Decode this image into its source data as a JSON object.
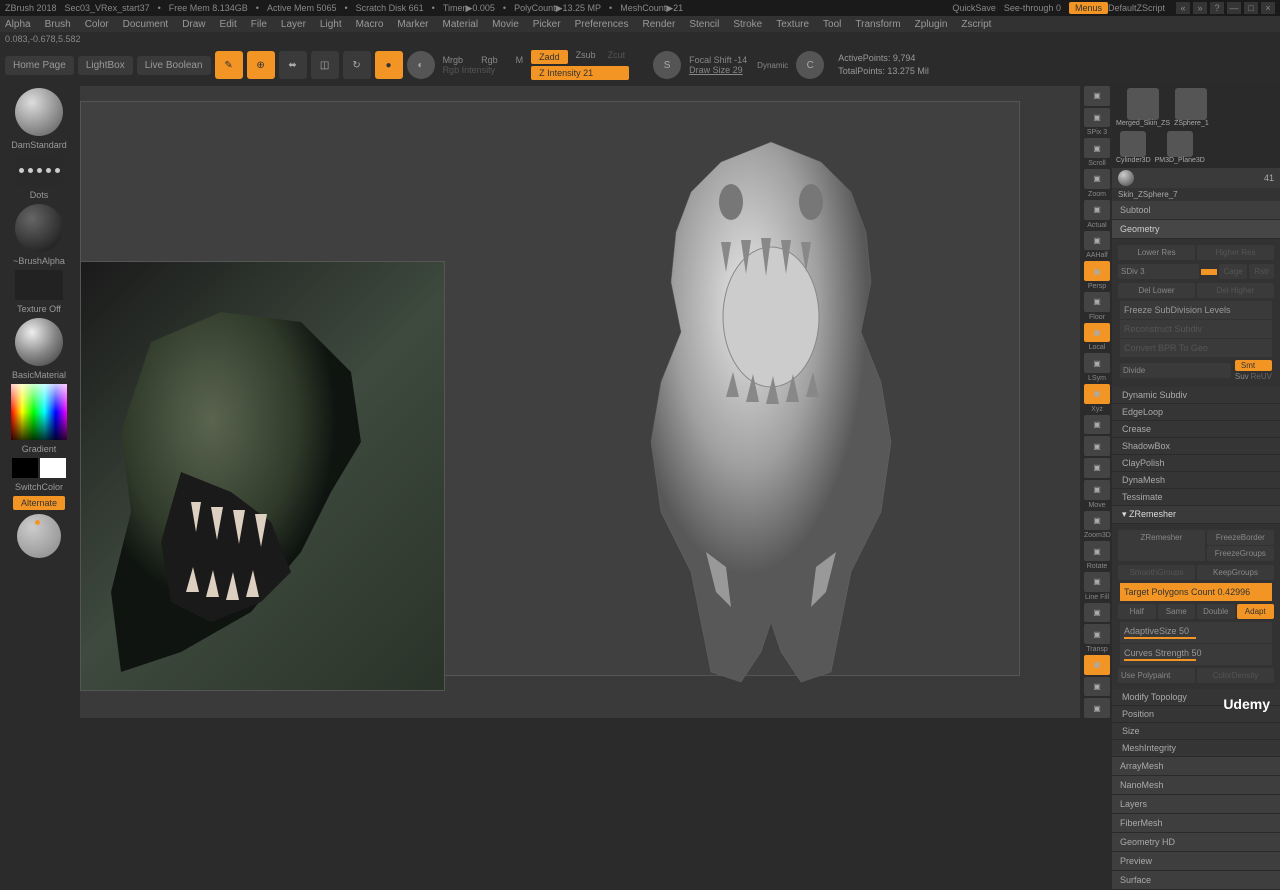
{
  "titlebar": {
    "app": "ZBrush 2018",
    "file": "Sec03_VRex_start37",
    "mem": "Free Mem 8.134GB",
    "activemem": "Active Mem 5065",
    "scratch": "Scratch Disk 661",
    "timer": "Timer▶0.005",
    "poly": "PolyCount▶13.25 MP",
    "mesh": "MeshCount▶21",
    "quicksave": "QuickSave",
    "seethrough": "See-through  0",
    "menus": "Menus",
    "script": "DefaultZScript"
  },
  "menubar": [
    "Alpha",
    "Brush",
    "Color",
    "Document",
    "Draw",
    "Edit",
    "File",
    "Layer",
    "Light",
    "Macro",
    "Marker",
    "Material",
    "Movie",
    "Picker",
    "Preferences",
    "Render",
    "Stencil",
    "Stroke",
    "Texture",
    "Tool",
    "Transform",
    "Zplugin",
    "Zscript"
  ],
  "coords": "0.083,-0.678,5.582",
  "toolbar": {
    "home": "Home Page",
    "lightbox": "LightBox",
    "liveboolean": "Live Boolean",
    "mrgb": "Mrgb",
    "rgb": "Rgb",
    "m": "M",
    "rgbint": "Rgb Intensity",
    "zadd": "Zadd",
    "zsub": "Zsub",
    "zcut": "Zcut",
    "zint": "Z Intensity 21",
    "focal": "Focal Shift -14",
    "drawsize": "Draw Size 29",
    "dynamic": "Dynamic",
    "activepoints": "ActivePoints: 9,794",
    "totalpoints": "TotalPoints: 13.275 Mil"
  },
  "left": {
    "brush": "DamStandard",
    "stroke": "Dots",
    "alpha": "~BrushAlpha",
    "texture": "Texture Off",
    "material": "BasicMaterial",
    "gradient": "Gradient",
    "switchcolor": "SwitchColor",
    "alternate": "Alternate"
  },
  "sideIcons": [
    {
      "label": "",
      "name": "bpr-icon"
    },
    {
      "label": "SPix 3",
      "name": "spix-icon"
    },
    {
      "label": "Scroll",
      "name": "scroll-icon"
    },
    {
      "label": "Zoom",
      "name": "zoom-icon"
    },
    {
      "label": "Actual",
      "name": "actual-icon"
    },
    {
      "label": "AAHalf",
      "name": "aahalf-icon"
    },
    {
      "label": "Persp",
      "name": "persp-icon",
      "active": true
    },
    {
      "label": "Floor",
      "name": "floor-icon"
    },
    {
      "label": "Local",
      "name": "local-icon",
      "active": true
    },
    {
      "label": "LSym",
      "name": "lsym-icon"
    },
    {
      "label": "Xyz",
      "name": "xpose-icon",
      "active": true
    },
    {
      "label": "",
      "name": "fit-icon"
    },
    {
      "label": "",
      "name": "frame-icon"
    },
    {
      "label": "",
      "name": "xyz2-icon"
    },
    {
      "label": "Move",
      "name": "move-icon"
    },
    {
      "label": "Zoom3D",
      "name": "zoom3d-icon"
    },
    {
      "label": "Rotate",
      "name": "rotate-icon"
    },
    {
      "label": "Line Fill",
      "name": "linefill-icon"
    },
    {
      "label": "",
      "name": "polyf-icon"
    },
    {
      "label": "Transp",
      "name": "transp-icon"
    },
    {
      "label": "",
      "name": "ghost-icon",
      "active": true
    },
    {
      "label": "",
      "name": "solo-icon"
    },
    {
      "label": "",
      "name": "xpose2-icon"
    }
  ],
  "right": {
    "thumbs": [
      "Merged_Skin_ZS",
      "ZSphere_1",
      "Cylinder3D",
      "PM3D_Plane3D"
    ],
    "count41": "41",
    "skin": "Skin_ZSphere_7",
    "sections": [
      "Subtool",
      "Geometry"
    ],
    "geo": {
      "lowerres": "Lower Res",
      "higherres": "Higher Res",
      "sdiv": "SDiv 3",
      "cage": "Cage",
      "rstr": "Rstr",
      "dellower": "Del Lower",
      "delhigher": "Del Higher",
      "freeze": "Freeze SubDivision Levels",
      "reconstruct": "Reconstruct Subdiv",
      "convert": "Convert BPR To Geo",
      "divide": "Divide",
      "smt": "Smt",
      "suv": "Suv",
      "reuv": "ReUV"
    },
    "subsections": [
      "Dynamic Subdiv",
      "EdgeLoop",
      "Crease",
      "ShadowBox",
      "ClayPolish",
      "DynaMesh",
      "Tessimate",
      "ZRemesher"
    ],
    "zremesher": {
      "btn": "ZRemesher",
      "freezeborder": "FreezeBorder",
      "freezegroups": "FreezeGroups",
      "smoothgroups": "SmoothGroups",
      "keepgroups": "KeepGroups",
      "target": "Target Polygons Count 0.42996",
      "half": "Half",
      "same": "Same",
      "double": "Double",
      "adapt": "Adapt",
      "adaptive": "AdaptiveSize 50",
      "curves": "Curves Strength 50",
      "polypaint": "Use Polypaint",
      "colordensity": "ColorDensity"
    },
    "more": [
      "Modify Topology",
      "Position",
      "Size",
      "MeshIntegrity"
    ],
    "moresections": [
      "ArrayMesh",
      "NanoMesh",
      "Layers",
      "FiberMesh",
      "Geometry HD",
      "Preview",
      "Surface"
    ]
  },
  "watermark": "Udemy"
}
